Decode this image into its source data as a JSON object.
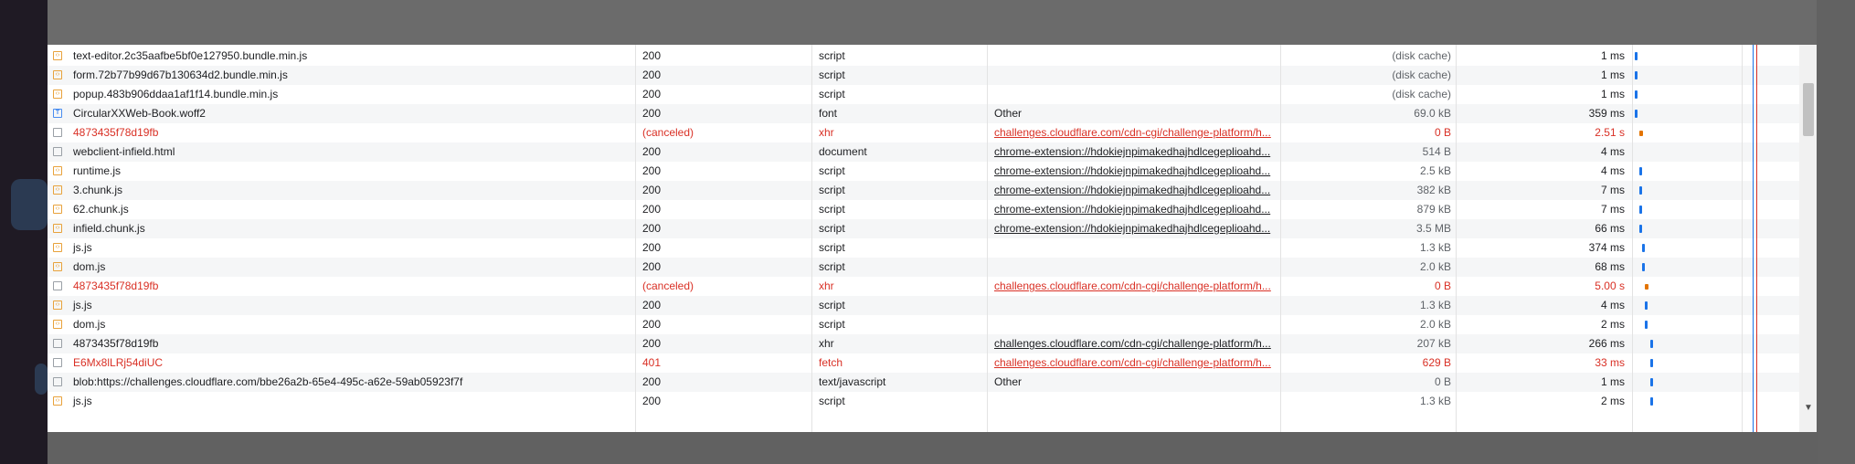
{
  "network": {
    "rows": [
      {
        "name": "text-editor.2c35aafbe5bf0e127950.bundle.min.js",
        "status": "200",
        "type": "script",
        "initiator": "",
        "size": "(disk cache)",
        "time": "1 ms",
        "icon": "script-icon",
        "error": false,
        "wf": "0.5%"
      },
      {
        "name": "form.72b77b99d67b130634d2.bundle.min.js",
        "status": "200",
        "type": "script",
        "initiator": "",
        "size": "(disk cache)",
        "time": "1 ms",
        "icon": "script-icon",
        "error": false,
        "wf": "0.5%"
      },
      {
        "name": "popup.483b906ddaa1af1f14.bundle.min.js",
        "status": "200",
        "type": "script",
        "initiator": "",
        "size": "(disk cache)",
        "time": "1 ms",
        "icon": "script-icon",
        "error": false,
        "wf": "0.5%"
      },
      {
        "name": "CircularXXWeb-Book.woff2",
        "status": "200",
        "type": "font",
        "initiator": "Other",
        "size": "69.0 kB",
        "time": "359 ms",
        "icon": "font-icon",
        "error": false,
        "wf": "1%"
      },
      {
        "name": "4873435f78d19fb",
        "status": "(canceled)",
        "type": "xhr",
        "initiator": "challenges.cloudflare.com/cdn-cgi/challenge-platform/h...",
        "size": "0 B",
        "time": "2.51 s",
        "icon": "blank-icon",
        "error": true,
        "wf": "6%"
      },
      {
        "name": "webclient-infield.html",
        "status": "200",
        "type": "document",
        "initiator": "chrome-extension://hdokiejnpimakedhajhdlcegeplioahd...",
        "size": "514 B",
        "time": "4 ms",
        "icon": "document-icon",
        "error": false,
        "wf": "-"
      },
      {
        "name": "runtime.js",
        "status": "200",
        "type": "script",
        "initiator": "chrome-extension://hdokiejnpimakedhajhdlcegeplioahd...",
        "size": "2.5 kB",
        "time": "4 ms",
        "icon": "script-icon",
        "error": false,
        "wf": "6%"
      },
      {
        "name": "3.chunk.js",
        "status": "200",
        "type": "script",
        "initiator": "chrome-extension://hdokiejnpimakedhajhdlcegeplioahd...",
        "size": "382 kB",
        "time": "7 ms",
        "icon": "script-icon",
        "error": false,
        "wf": "6%"
      },
      {
        "name": "62.chunk.js",
        "status": "200",
        "type": "script",
        "initiator": "chrome-extension://hdokiejnpimakedhajhdlcegeplioahd...",
        "size": "879 kB",
        "time": "7 ms",
        "icon": "script-icon",
        "error": false,
        "wf": "6%"
      },
      {
        "name": "infield.chunk.js",
        "status": "200",
        "type": "script",
        "initiator": "chrome-extension://hdokiejnpimakedhajhdlcegeplioahd...",
        "size": "3.5 MB",
        "time": "66 ms",
        "icon": "script-icon",
        "error": false,
        "wf": "6%"
      },
      {
        "name": "js.js",
        "status": "200",
        "type": "script",
        "initiator": "",
        "size": "1.3 kB",
        "time": "374 ms",
        "icon": "script-icon",
        "error": false,
        "wf": "9%"
      },
      {
        "name": "dom.js",
        "status": "200",
        "type": "script",
        "initiator": "",
        "size": "2.0 kB",
        "time": "68 ms",
        "icon": "script-icon",
        "error": false,
        "wf": "9%"
      },
      {
        "name": "4873435f78d19fb",
        "status": "(canceled)",
        "type": "xhr",
        "initiator": "challenges.cloudflare.com/cdn-cgi/challenge-platform/h...",
        "size": "0 B",
        "time": "5.00 s",
        "icon": "blank-icon",
        "error": true,
        "wf": "12%"
      },
      {
        "name": "js.js",
        "status": "200",
        "type": "script",
        "initiator": "",
        "size": "1.3 kB",
        "time": "4 ms",
        "icon": "script-icon",
        "error": false,
        "wf": "12%"
      },
      {
        "name": "dom.js",
        "status": "200",
        "type": "script",
        "initiator": "",
        "size": "2.0 kB",
        "time": "2 ms",
        "icon": "script-icon",
        "error": false,
        "wf": "12%"
      },
      {
        "name": "4873435f78d19fb",
        "status": "200",
        "type": "xhr",
        "initiator": "challenges.cloudflare.com/cdn-cgi/challenge-platform/h...",
        "size": "207 kB",
        "time": "266 ms",
        "icon": "blank-icon",
        "error": false,
        "wf": "18%"
      },
      {
        "name": "E6Mx8lLRj54diUC",
        "status": "401",
        "type": "fetch",
        "initiator": "challenges.cloudflare.com/cdn-cgi/challenge-platform/h...",
        "size": "629 B",
        "time": "33 ms",
        "icon": "blank-icon",
        "error": true,
        "wf": "18%"
      },
      {
        "name": "blob:https://challenges.cloudflare.com/bbe26a2b-65e4-495c-a62e-59ab05923f7f",
        "status": "200",
        "type": "text/javascript",
        "initiator": "Other",
        "size": "0 B",
        "time": "1 ms",
        "icon": "blank-icon",
        "error": false,
        "wf": "18%"
      },
      {
        "name": "js.js",
        "status": "200",
        "type": "script",
        "initiator": "",
        "size": "1.3 kB",
        "time": "2 ms",
        "icon": "script-icon",
        "error": false,
        "wf": "18%"
      }
    ]
  },
  "colors": {
    "error": "#d93025",
    "link": "#202124",
    "waterfall_blue": "#1a73e8",
    "waterfall_orange": "#e37400",
    "dom_line": "#1a73e8",
    "load_line": "#d93025"
  }
}
